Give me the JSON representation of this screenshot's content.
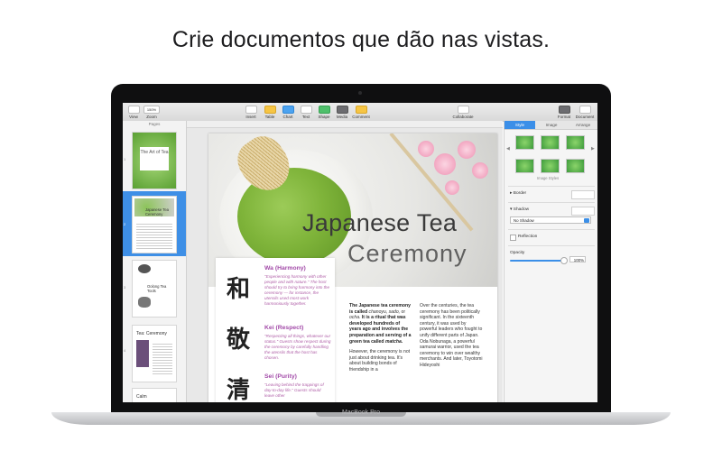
{
  "headline": "Crie documentos que dão nas vistas.",
  "device_label": "MacBook Pro",
  "toolbar": {
    "view": "View",
    "zoom_value": "150%",
    "zoom": "Zoom",
    "insert": "Insert",
    "table": "Table",
    "chart": "Chart",
    "text": "Text",
    "shape": "Shape",
    "media": "Media",
    "comment": "Comment",
    "collaborate": "Collaborate",
    "format": "Format",
    "document": "Document"
  },
  "pages_panel": {
    "title": "Pages",
    "thumbnails": [
      {
        "num": "1",
        "title": "The Art of Tea"
      },
      {
        "num": "2",
        "title": "Japanese Tea Ceremony"
      },
      {
        "num": "3",
        "title": "Oolong Tea Tools"
      },
      {
        "num": "4",
        "title": "Tea: Ceremony"
      },
      {
        "num": "5",
        "title": "Calm"
      }
    ]
  },
  "document": {
    "title_line1": "Japanese Tea",
    "title_line2": "Ceremony",
    "kanji": [
      "和",
      "敬",
      "清"
    ],
    "principles": [
      {
        "head": "Wa (Harmony)",
        "text": "\"Experiencing harmony with other people and with nature.\" The host should try to bring harmony into the ceremony — for instance, the utensils used most work harmoniously together."
      },
      {
        "head": "Kei (Respect)",
        "text": "\"Respecting all things, whatever our status.\" Guests show respect during the ceremony by carefully handling the utensils that the host has chosen."
      },
      {
        "head": "Sei (Purity)",
        "text": "\"Leaving behind the trappings of day-to-day life.\" Guests should leave other"
      }
    ],
    "col1_bold": "The Japanese tea ceremony is called",
    "col1_italic": "chanoyu, sado,",
    "col1_mid": "or",
    "col1_italic2": "ocha.",
    "col1_bold2": "It is a ritual that was developed hundreds of years ago and involves the preparation and serving of a green tea called",
    "col1_matcha": "matcha.",
    "col1_p2": "However, the ceremony is not just about drinking tea. It's about building bonds of friendship in a",
    "col2_text": "Over the centuries, the tea ceremony has been politically significant. In the sixteenth century, it was used by powerful leaders who fought to unify different parts of Japan. Oda Nobunaga, a powerful samurai warrior, used the tea ceremony to win over wealthy merchants. And later, Toyotomi Hideyoshi"
  },
  "inspector": {
    "tabs": [
      "Style",
      "Image",
      "Arrange"
    ],
    "image_styles": "Image Styles",
    "border": "Border",
    "shadow": "Shadow",
    "shadow_value": "No Shadow",
    "reflection": "Reflection",
    "opacity": "Opacity",
    "opacity_value": "100%"
  },
  "colors": {
    "accent": "#3b8fe8",
    "principle_head": "#a24aa8",
    "matcha": "#7fb43a"
  }
}
